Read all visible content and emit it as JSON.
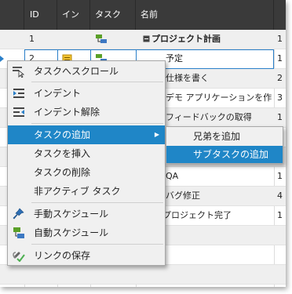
{
  "grid": {
    "headers": [
      "ID",
      "イン",
      "タスク",
      "名前"
    ],
    "rows": [
      {
        "id": "1",
        "name": "プロジェクト計画",
        "rest": "1"
      },
      {
        "id": "2",
        "name": "予定",
        "rest": "1"
      },
      {
        "id": "",
        "name": "仕様を書く",
        "rest": "2"
      },
      {
        "id": "",
        "name": "デモ アプリケーションを作",
        "rest": "3"
      },
      {
        "id": "",
        "name": "フィードバックの取得",
        "rest": "1"
      },
      {
        "id": "",
        "name": "",
        "rest": "2"
      },
      {
        "id": "",
        "name": "",
        "rest": "2"
      },
      {
        "id": "",
        "name": "QA",
        "rest": "1"
      },
      {
        "id": "",
        "name": "バグ修正",
        "rest": "4"
      },
      {
        "id": "",
        "name": "プロジェクト完了",
        "rest": "1"
      }
    ]
  },
  "context_menu": {
    "items": [
      {
        "label": "タスクへスクロール",
        "icon": "scroll-to-task-icon"
      },
      {
        "label": "インデント",
        "icon": "indent-icon"
      },
      {
        "label": "インデント解除",
        "icon": "outdent-icon"
      },
      {
        "label": "タスクの追加",
        "icon": "",
        "has_submenu": true,
        "highlighted": true
      },
      {
        "label": "タスクを挿入",
        "icon": ""
      },
      {
        "label": "タスクの削除",
        "icon": ""
      },
      {
        "label": "非アクティブ タスク",
        "icon": ""
      },
      {
        "label": "手動スケジュール",
        "icon": "pin-icon"
      },
      {
        "label": "自動スケジュール",
        "icon": "auto-schedule-icon"
      },
      {
        "label": "リンクの保存",
        "icon": "link-save-icon"
      }
    ]
  },
  "submenu": {
    "items": [
      {
        "label": "兄弟を追加"
      },
      {
        "label": "サブタスクの追加",
        "highlighted": true
      }
    ]
  },
  "colors": {
    "header_bg": "#3a3a3a",
    "highlight": "#1f86c7",
    "selection_border": "#2a7fc9"
  }
}
